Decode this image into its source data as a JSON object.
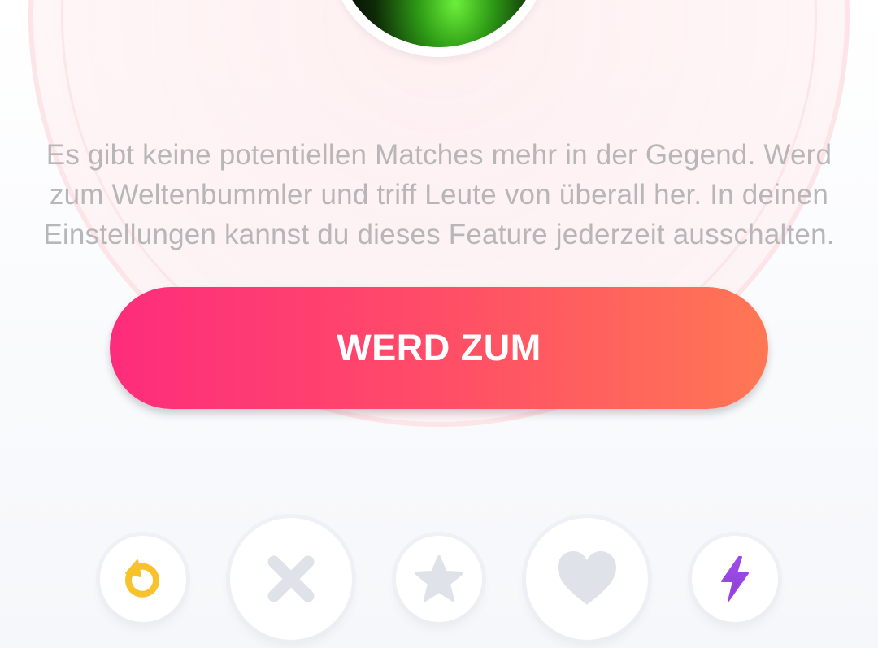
{
  "empty_state": {
    "message_lines": [
      "Es gibt keine potentiellen Matches mehr in der Gegend. Werd",
      "zum Weltenbummler und triff Leute von überall her. In deinen",
      "Einstellungen kannst du dieses Feature jederzeit ausschalten."
    ],
    "cta_label": "WERD ZUM"
  },
  "action_bar": {
    "buttons": [
      {
        "name": "rewind",
        "icon": "rewind-icon",
        "color": "#f8c22a"
      },
      {
        "name": "nope",
        "icon": "close-icon",
        "color": "#dfe2e8"
      },
      {
        "name": "super-like",
        "icon": "star-icon",
        "color": "#dfe2e8"
      },
      {
        "name": "like",
        "icon": "heart-icon",
        "color": "#dfe2e8"
      },
      {
        "name": "boost",
        "icon": "lightning-icon",
        "color": "#9a47e4"
      }
    ]
  },
  "colors": {
    "cta_gradient_start": "#fe2c7c",
    "cta_gradient_end": "#ff7754",
    "message_text": "#b8b6b9"
  }
}
